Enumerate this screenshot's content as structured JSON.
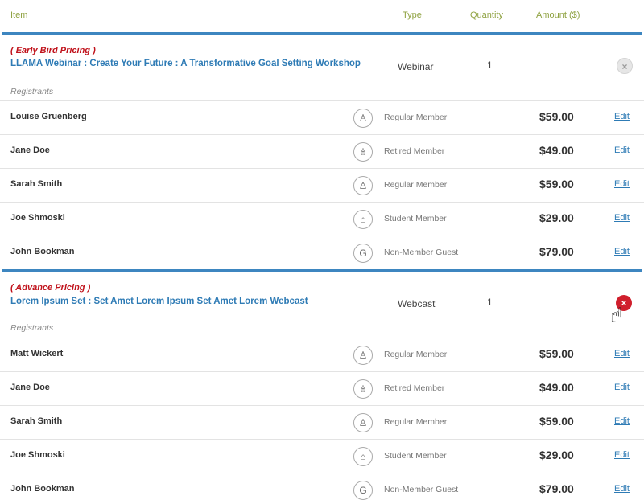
{
  "header": {
    "item": "Item",
    "type": "Type",
    "quantity": "Quantity",
    "amount": "Amount ($)"
  },
  "groups": [
    {
      "pricing": "( Early Bird Pricing )",
      "title": "LLAMA Webinar : Create Your Future : A Transformative Goal Setting Workshop",
      "type": "Webinar",
      "quantity": "1",
      "registrants_label": "Registrants",
      "remove_icon": "×",
      "rows": [
        {
          "name": "Louise Gruenberg",
          "icon": "person-icon",
          "glyph": "♙",
          "member": "Regular Member",
          "amount": "$59.00",
          "edit": "Edit"
        },
        {
          "name": "Jane Doe",
          "icon": "retired-person-icon",
          "glyph": "♗",
          "member": "Retired Member",
          "amount": "$49.00",
          "edit": "Edit"
        },
        {
          "name": "Sarah Smith",
          "icon": "person-icon",
          "glyph": "♙",
          "member": "Regular Member",
          "amount": "$59.00",
          "edit": "Edit"
        },
        {
          "name": "Joe Shmoski",
          "icon": "graduation-cap-icon",
          "glyph": "⌂",
          "member": "Student Member",
          "amount": "$29.00",
          "edit": "Edit"
        },
        {
          "name": "John Bookman",
          "icon": "guest-icon",
          "glyph": "G",
          "member": "Non-Member Guest",
          "amount": "$79.00",
          "edit": "Edit"
        }
      ]
    },
    {
      "pricing": "( Advance Pricing )",
      "title": "Lorem Ipsum Set : Set Amet Lorem Ipsum Set Amet Lorem Webcast",
      "type": "Webcast",
      "quantity": "1",
      "registrants_label": "Registrants",
      "remove_icon": "×",
      "rows": [
        {
          "name": "Matt Wickert",
          "icon": "person-icon",
          "glyph": "♙",
          "member": "Regular Member",
          "amount": "$59.00",
          "edit": "Edit"
        },
        {
          "name": "Jane Doe",
          "icon": "retired-person-icon",
          "glyph": "♗",
          "member": "Retired Member",
          "amount": "$49.00",
          "edit": "Edit"
        },
        {
          "name": "Sarah Smith",
          "icon": "person-icon",
          "glyph": "♙",
          "member": "Regular Member",
          "amount": "$59.00",
          "edit": "Edit"
        },
        {
          "name": "Joe Shmoski",
          "icon": "graduation-cap-icon",
          "glyph": "⌂",
          "member": "Student Member",
          "amount": "$29.00",
          "edit": "Edit"
        },
        {
          "name": "John Bookman",
          "icon": "guest-icon",
          "glyph": "G",
          "member": "Non-Member Guest",
          "amount": "$79.00",
          "edit": "Edit"
        }
      ]
    }
  ],
  "cursor": {
    "icon": "hand-pointer-icon",
    "glyph": "☝"
  },
  "colors": {
    "header_text": "#8fa241",
    "accent_bar": "#3d86c0",
    "pricing_red": "#c0121b",
    "link_blue": "#2e7bb5",
    "remove_active": "#d01f2c"
  }
}
